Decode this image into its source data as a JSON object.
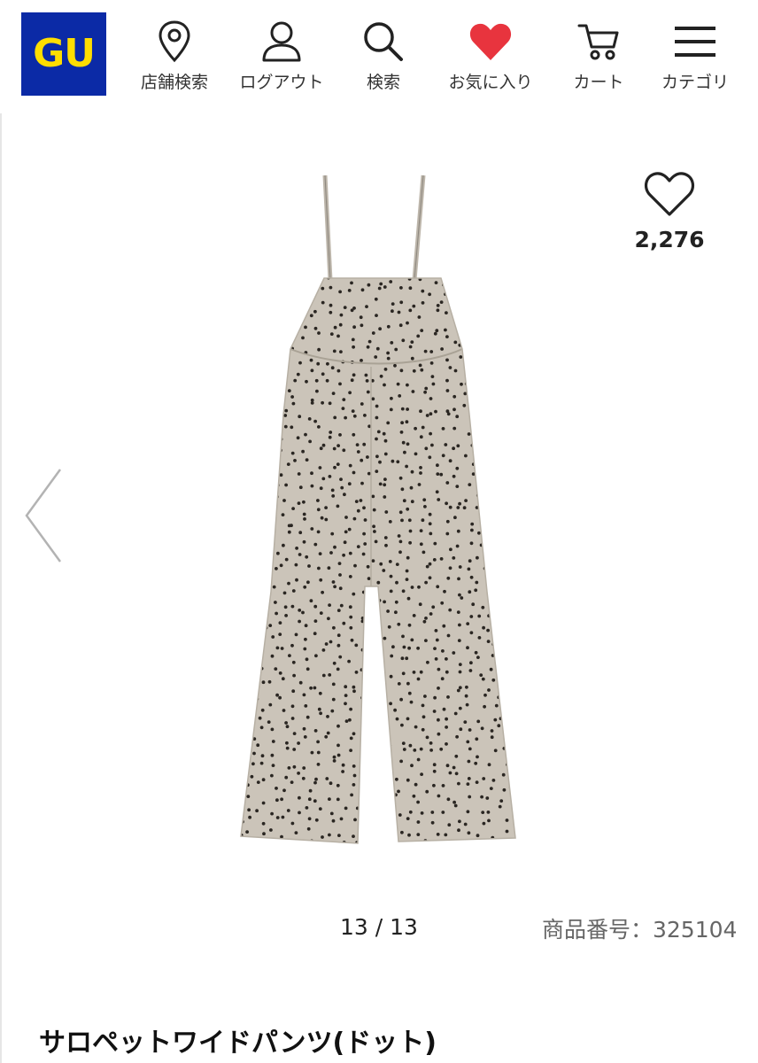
{
  "brand": {
    "logo_text": "GU",
    "logo_bg": "#0b2aa6",
    "logo_fg": "#ffde00"
  },
  "nav": [
    {
      "id": "store",
      "label": "店舗検索",
      "icon": "map-pin-icon"
    },
    {
      "id": "logout",
      "label": "ログアウト",
      "icon": "user-icon"
    },
    {
      "id": "search",
      "label": "検索",
      "icon": "search-icon"
    },
    {
      "id": "favorites",
      "label": "お気に入り",
      "icon": "heart-filled-icon",
      "color": "#e8343e"
    },
    {
      "id": "cart",
      "label": "カート",
      "icon": "cart-icon"
    },
    {
      "id": "category",
      "label": "カテゴリ",
      "icon": "hamburger-icon"
    }
  ],
  "product": {
    "favorite_count": "2,276",
    "image_counter": "13 / 13",
    "code_label": "商品番号：325104",
    "title": "サロペットワイドパンツ(ドット)",
    "fabric_color": "#cbc4b9",
    "dot_color": "#2a2622"
  }
}
